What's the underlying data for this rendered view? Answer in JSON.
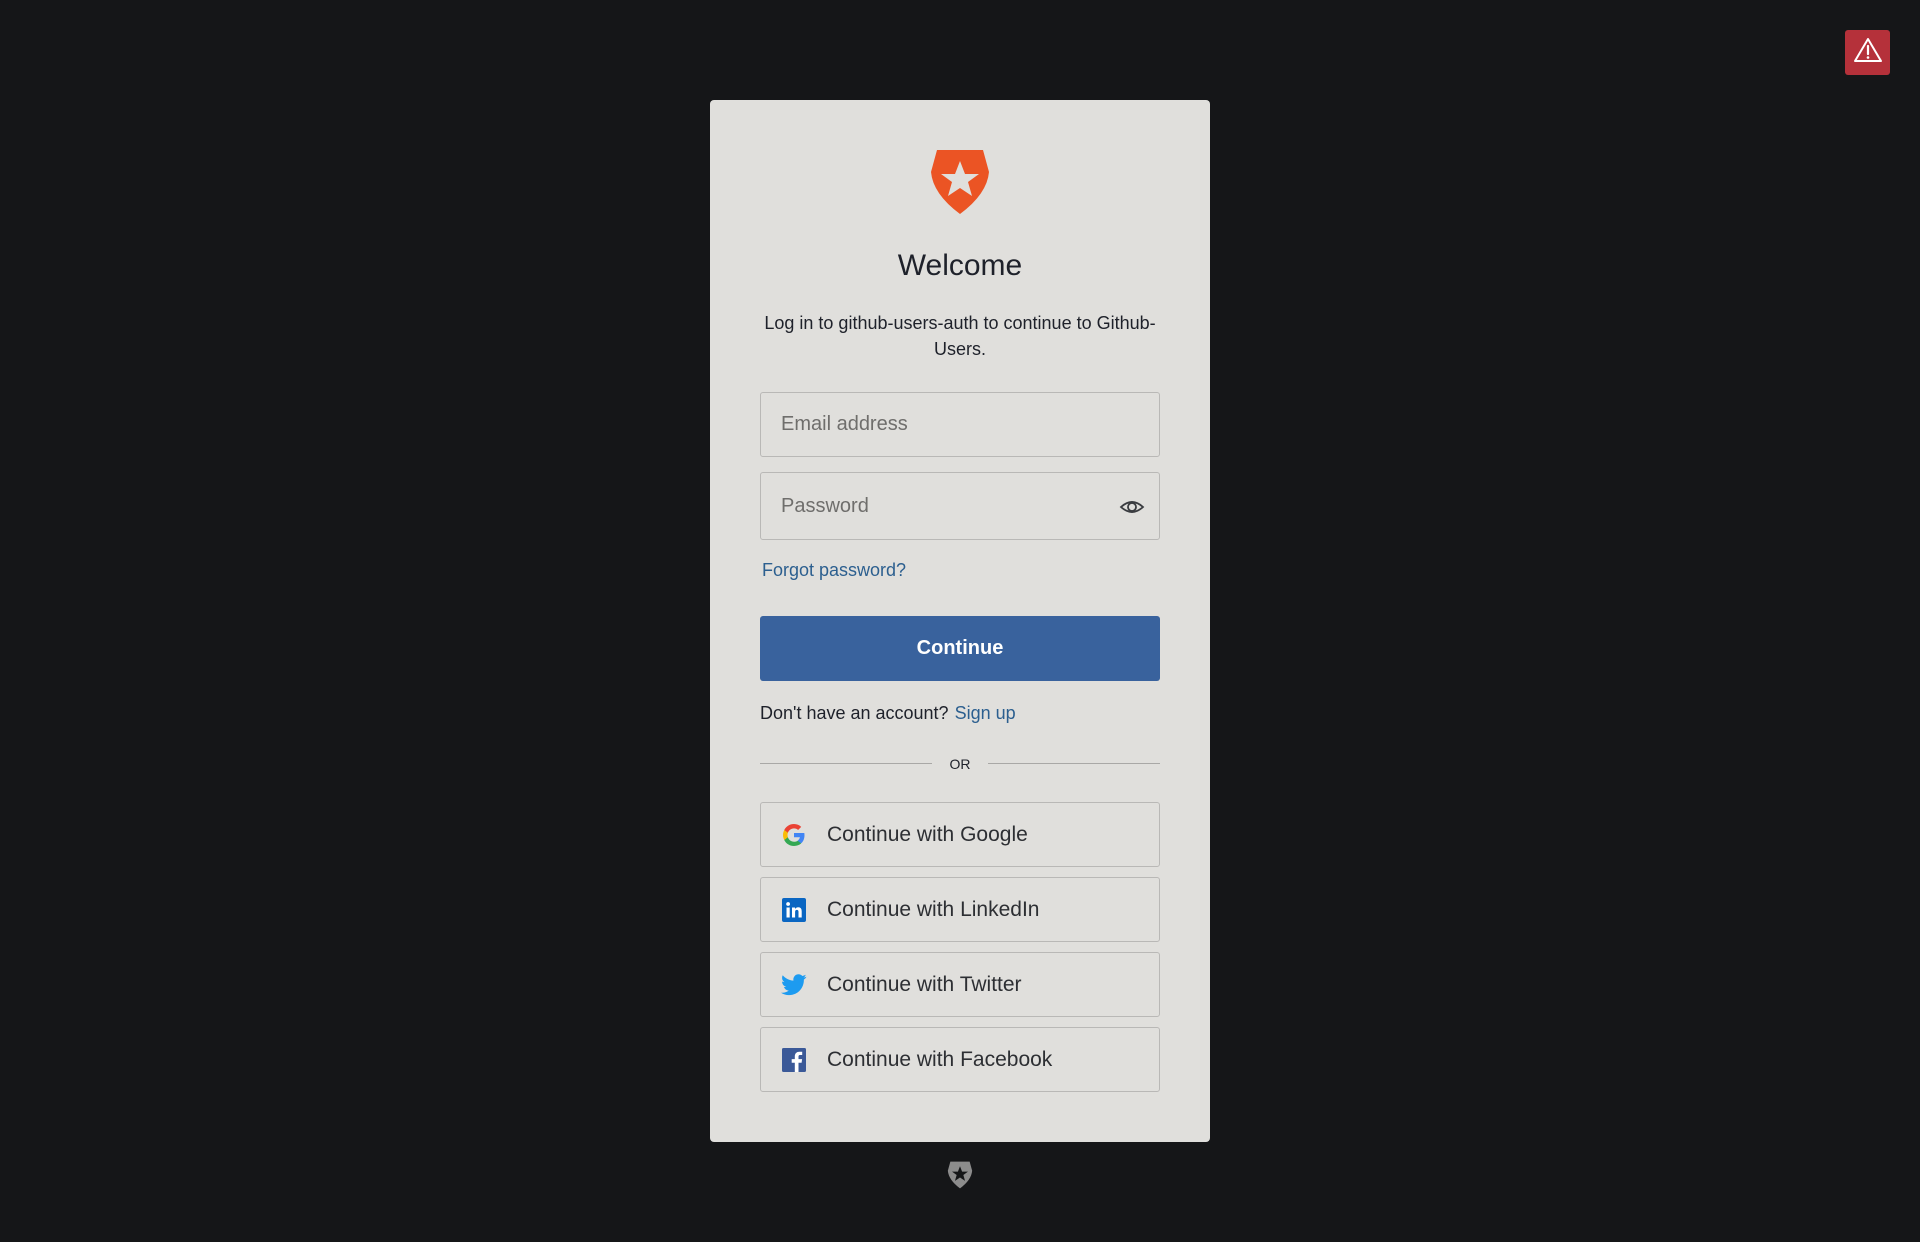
{
  "header": {
    "warning_icon": "warning-triangle-icon"
  },
  "card": {
    "logo_icon": "auth0-shield-star-logo",
    "title": "Welcome",
    "subtitle": "Log in to github-users-auth to continue to Github-Users.",
    "email": {
      "placeholder": "Email address",
      "value": ""
    },
    "password": {
      "placeholder": "Password",
      "value": "",
      "toggle_icon": "eye-icon"
    },
    "forgot_password_label": "Forgot password?",
    "continue_label": "Continue",
    "signup": {
      "prompt": "Don't have an account?",
      "link_label": "Sign up"
    },
    "divider_label": "OR",
    "social": [
      {
        "label": "Continue with Google",
        "icon": "google-icon"
      },
      {
        "label": "Continue with LinkedIn",
        "icon": "linkedin-icon"
      },
      {
        "label": "Continue with Twitter",
        "icon": "twitter-icon"
      },
      {
        "label": "Continue with Facebook",
        "icon": "facebook-icon"
      }
    ]
  },
  "footer": {
    "logo_icon": "auth0-footer-logo"
  },
  "colors": {
    "background": "#151618",
    "card": "#e0dfdc",
    "primary": "#39629d",
    "link": "#2c5f8f",
    "logo": "#eb5424",
    "warning": "#b5313a"
  }
}
